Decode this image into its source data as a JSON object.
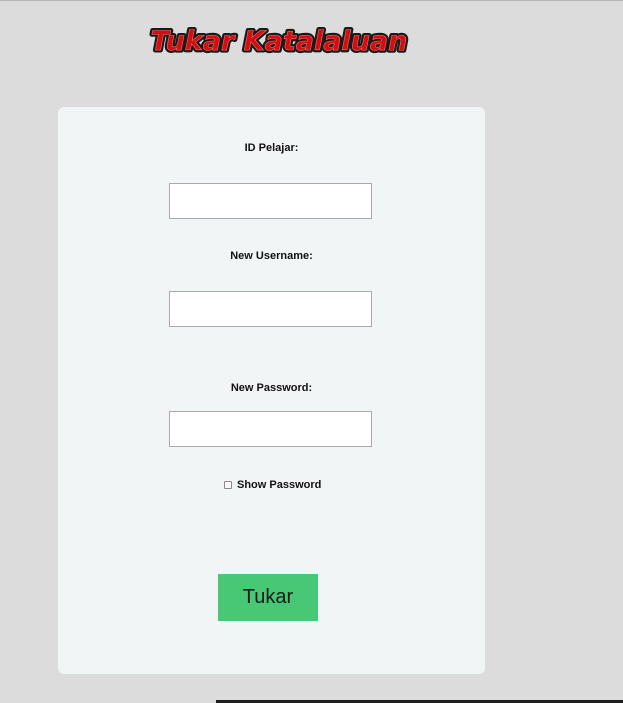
{
  "header": {
    "title": "Tukar Katalaluan"
  },
  "form": {
    "student_id_label": "ID Pelajar:",
    "student_id_value": "",
    "username_label": "New Username:",
    "username_value": "",
    "password_label": "New Password:",
    "password_value": "",
    "show_password_label": "Show Password",
    "show_password_checked": false,
    "submit_label": "Tukar"
  },
  "colors": {
    "page_background": "#dcdcdc",
    "card_background": "#f1f5f6",
    "button": "#48c774",
    "title_fill": "#d01010",
    "title_outline": "#1a1a1a"
  }
}
